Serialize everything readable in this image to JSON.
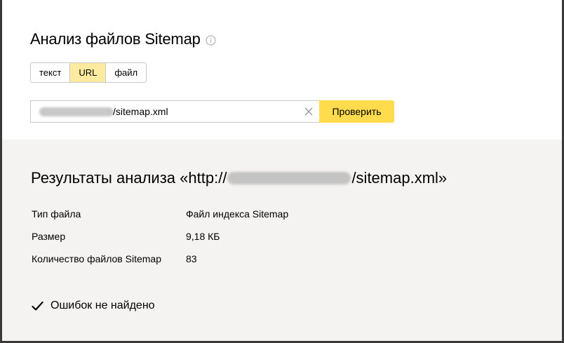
{
  "header": {
    "title": "Анализ файлов Sitemap",
    "info_icon": "info-icon"
  },
  "mode_tabs": [
    {
      "label": "текст",
      "active": false
    },
    {
      "label": "URL",
      "active": true
    },
    {
      "label": "файл",
      "active": false
    }
  ],
  "url_form": {
    "value": "/sitemap.xml",
    "clear_icon": "close-icon",
    "submit_label": "Проверить"
  },
  "results": {
    "title_prefix": "Результаты анализа «http://",
    "title_suffix": "/sitemap.xml»",
    "rows": [
      {
        "key": "Тип файла",
        "value": "Файл индекса Sitemap"
      },
      {
        "key": "Размер",
        "value": "9,18 КБ"
      },
      {
        "key": "Количество файлов Sitemap",
        "value": "83"
      }
    ],
    "status_icon": "checkmark-icon",
    "status_text": "Ошибок не найдено"
  },
  "colors": {
    "accent": "#ffdb4d",
    "active_tab": "#ffeba0",
    "results_bg": "#f4f3f1"
  }
}
